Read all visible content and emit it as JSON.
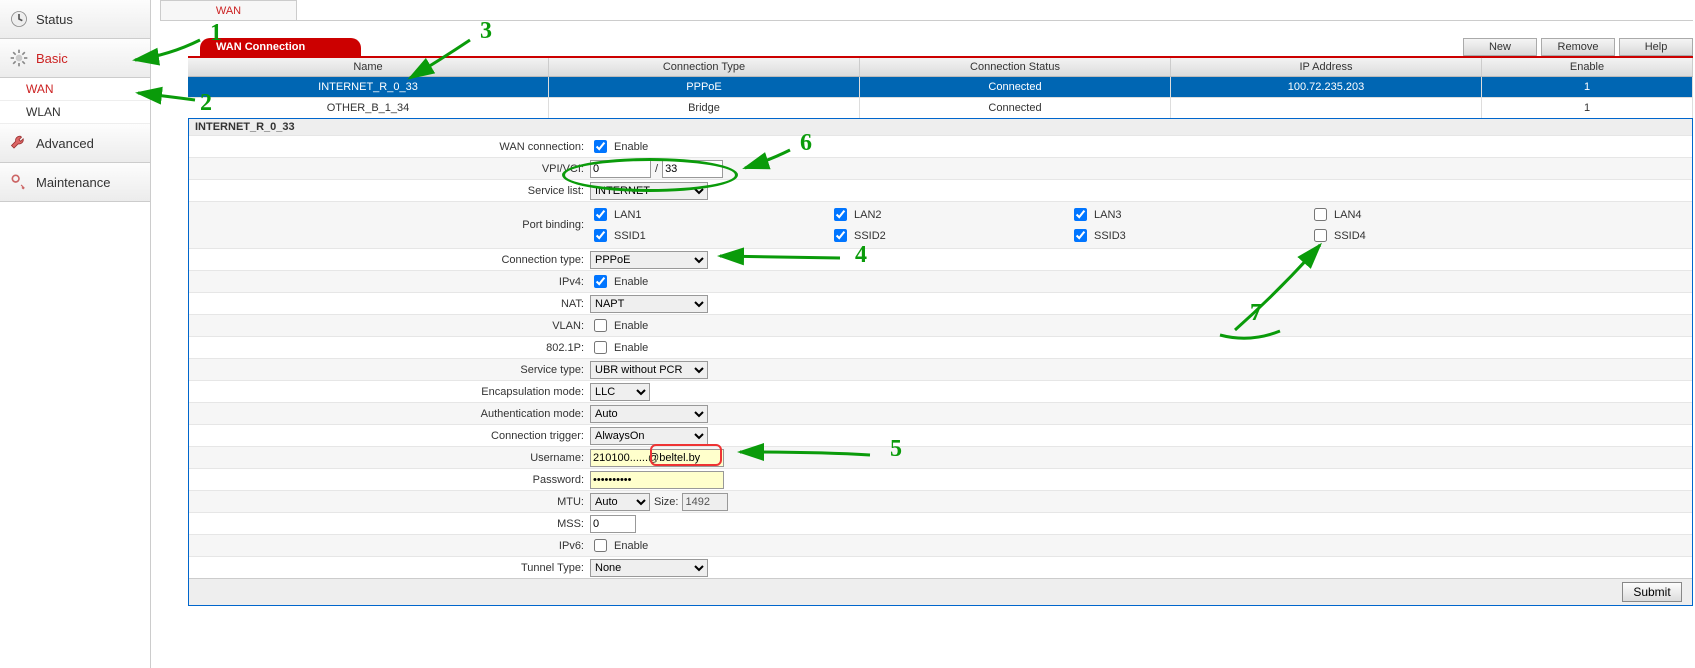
{
  "nav": {
    "status": "Status",
    "basic": "Basic",
    "wan": "WAN",
    "wlan": "WLAN",
    "advanced": "Advanced",
    "maintenance": "Maintenance"
  },
  "crumb": "WAN",
  "section_tab": "WAN Connection",
  "toolbar": {
    "new": "New",
    "remove": "Remove",
    "help": "Help"
  },
  "table": {
    "head": {
      "name": "Name",
      "type": "Connection Type",
      "status": "Connection Status",
      "ip": "IP Address",
      "enable": "Enable"
    },
    "rows": [
      {
        "name": "INTERNET_R_0_33",
        "type": "PPPoE",
        "status": "Connected",
        "ip": "100.72.235.203",
        "enable": "1",
        "selected": true
      },
      {
        "name": "OTHER_B_1_34",
        "type": "Bridge",
        "status": "Connected",
        "ip": "",
        "enable": "1",
        "selected": false
      }
    ]
  },
  "form": {
    "title": "INTERNET_R_0_33",
    "labels": {
      "wan_conn": "WAN connection:",
      "vpi_vci": "VPI/VCI:",
      "service_list": "Service list:",
      "port_binding": "Port binding:",
      "conn_type": "Connection type:",
      "ipv4": "IPv4:",
      "nat": "NAT:",
      "vlan": "VLAN:",
      "dot1p": "802.1P:",
      "service_type": "Service type:",
      "encap": "Encapsulation mode:",
      "auth": "Authentication mode:",
      "trigger": "Connection trigger:",
      "username": "Username:",
      "password": "Password:",
      "mtu": "MTU:",
      "mtu_size": "Size:",
      "mss": "MSS:",
      "ipv6": "IPv6:",
      "tunnel": "Tunnel Type:",
      "enable_cb": "Enable",
      "slash": " / "
    },
    "values": {
      "wan_conn_chk": true,
      "vpi": "0",
      "vci": "33",
      "service_list": "INTERNET",
      "bindings": {
        "LAN1": true,
        "LAN2": true,
        "LAN3": true,
        "LAN4": false,
        "SSID1": true,
        "SSID2": true,
        "SSID3": true,
        "SSID4": false
      },
      "conn_type": "PPPoE",
      "ipv4_chk": true,
      "nat": "NAPT",
      "vlan_chk": false,
      "dot1p_chk": false,
      "service_type": "UBR without PCR",
      "encap": "LLC",
      "auth": "Auto",
      "trigger": "AlwaysOn",
      "username": "210100......@beltel.by",
      "password": "••••••••••",
      "mtu_mode": "Auto",
      "mtu_size": "1492",
      "mss": "0",
      "ipv6_chk": false,
      "tunnel": "None"
    },
    "submit": "Submit"
  },
  "annotations": [
    "1",
    "2",
    "3",
    "4",
    "5",
    "6",
    "7"
  ]
}
